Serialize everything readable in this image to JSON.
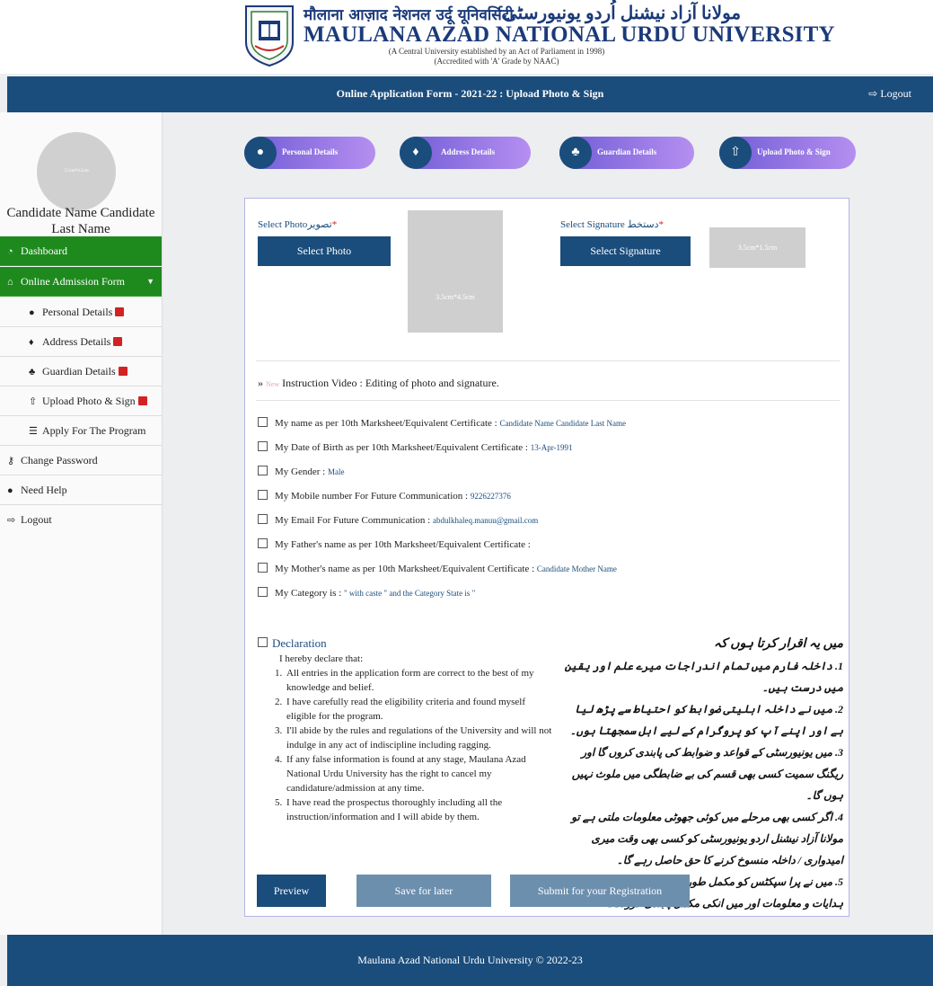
{
  "header": {
    "hindi": "मौलाना आज़ाद नेशनल उर्दू यूनिवर्सिटी",
    "urdu": "مولانا آزاد نیشنل اُردو یونیورسٹی",
    "english": "MAULANA AZAD NATIONAL URDU UNIVERSITY",
    "sub1": "(A Central University established by an Act of Parliament in 1998)",
    "sub2": "(Accredited with 'A' Grade by NAAC)"
  },
  "topbar": {
    "title": "Online Application Form - 2021-22 : Upload Photo & Sign",
    "logout": "Logout"
  },
  "sidebar": {
    "avatar_text": "3.5cm*4.5cm",
    "candidate_name": "Candidate Name Candidate Last Name",
    "items": [
      {
        "label": "Dashboard",
        "icon": "dashboard-icon"
      },
      {
        "label": "Online Admission Form",
        "icon": "home-icon"
      },
      {
        "label": "Personal Details",
        "icon": "user-icon"
      },
      {
        "label": "Address Details",
        "icon": "map-marker-icon"
      },
      {
        "label": "Guardian Details",
        "icon": "users-icon"
      },
      {
        "label": "Upload Photo & Sign",
        "icon": "upload-icon"
      },
      {
        "label": "Apply For The Program",
        "icon": "list-icon"
      },
      {
        "label": "Change Password",
        "icon": "key-icon"
      },
      {
        "label": "Need Help",
        "icon": "user-icon"
      },
      {
        "label": "Logout",
        "icon": "sign-out-icon"
      }
    ]
  },
  "steps": [
    {
      "label": "Personal Details",
      "icon": "user-icon"
    },
    {
      "label": "Address Details",
      "icon": "map-marker-icon"
    },
    {
      "label": "Guardian Details",
      "icon": "users-icon"
    },
    {
      "label": "Upload Photo & Sign",
      "icon": "upload-icon"
    }
  ],
  "form": {
    "photo_label": "Select Photo",
    "photo_label_urdu": "تصویر",
    "photo_button": "Select Photo",
    "photo_placeholder": "3.5cm*4.5cm",
    "sign_label": "Select Signature",
    "sign_label_urdu": "دستخط",
    "sign_button": "Select Signature",
    "sign_placeholder": "3.5cm*1.5cm",
    "instruction_new": "New",
    "instruction_text": "Instruction Video : Editing of photo and signature.",
    "checks": [
      {
        "label": "My name as per 10th Marksheet/Equivalent Certificate :",
        "value": "Candidate Name Candidate Last Name"
      },
      {
        "label": "My Date of Birth as per 10th Marksheet/Equivalent Certificate :",
        "value": "13-Apr-1991"
      },
      {
        "label": "My Gender :",
        "value": "Male"
      },
      {
        "label": "My Mobile number For Future Communication :",
        "value": "9226227376"
      },
      {
        "label": "My Email For Future Communication :",
        "value": "abdulkhaleq.manuu@gmail.com"
      },
      {
        "label": "My Father's name as per 10th Marksheet/Equivalent Certificate :",
        "value": ""
      },
      {
        "label": "My Mother's name as per 10th Marksheet/Equivalent Certificate :",
        "value": "Candidate Mother Name"
      },
      {
        "label": "My Category is :",
        "value": "\" with caste \" and the Category State is \""
      }
    ],
    "declaration_title": "Declaration",
    "declaration_intro": "I hereby declare that:",
    "declaration_items": [
      "All entries in the application form are correct to the best of my knowledge and belief.",
      "I have carefully read the eligibility criteria and found myself eligible for the program.",
      "I'll abide by the rules and regulations of the University and will not indulge in any act of indiscipline including ragging.",
      "If any false information is found at any stage, Maulana Azad National Urdu University has the right to cancel my candidature/admission at any time.",
      "I have read the prospectus thoroughly including all the instruction/information and I will abide by them."
    ],
    "urdu_head": "میں یہ اقرار کرتا ہوں کہ",
    "urdu_items": [
      "1. داخلہ فارم میں تمام اندراجات میرے علم اور یقین میں درست ہیں۔",
      "2. میں نے داخلہ اہلیتی ضوابط کو احتیاط سے پڑھ لیا ہے اور اپنے آپ کو پروگرام کے لیے اہل سمجھتا ہوں۔",
      "3. میں یونیورسٹی کے قواعد و ضوابط کی پابندی کروں گا اور ریگنگ سمیت کسی بھی قسم کی بے ضابطگی میں ملوث نہیں ہوں گا۔",
      "4. اگر کسی بھی مرحلے میں کوئی جھوٹی معلومات ملتی ہے تو مولانا آزاد نیشنل اردو یونیورسٹی کو کسی بھی وقت میری امیدواری / داخلہ منسوخ کرنے کا حق حاصل رہے گا۔",
      "5. میں نے پرا سپکٹس کو مکمل طور پر پڑھ لیا ہے بشمول تمام ہدایات و معلومات اور میں انکی مکمل پابندی کرونگا۔"
    ],
    "btn_preview": "Preview",
    "btn_save": "Save for later",
    "btn_submit": "Submit for your Registration"
  },
  "footer": "Maulana Azad National Urdu University © 2022-23"
}
